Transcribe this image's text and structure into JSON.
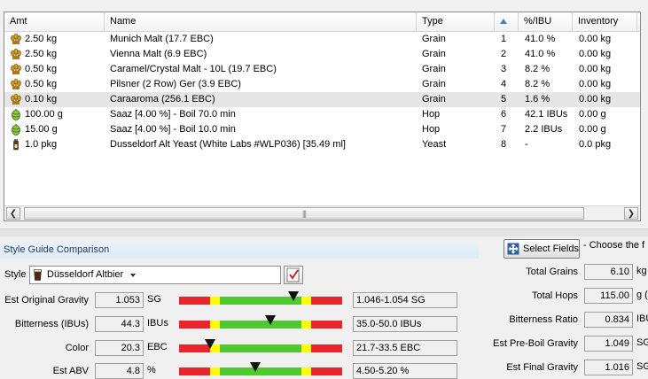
{
  "grid": {
    "columns": [
      "Amt",
      "Name",
      "Type",
      "",
      "%/IBU",
      "Inventory"
    ],
    "rows": [
      {
        "amt": "2.50 kg",
        "name": "Munich Malt (17.7 EBC)",
        "type": "Grain",
        "order": "1",
        "pct": "41.0 %",
        "inv": "0.00 kg",
        "icon": "grain-icon"
      },
      {
        "amt": "2.50 kg",
        "name": "Vienna Malt (6.9 EBC)",
        "type": "Grain",
        "order": "2",
        "pct": "41.0 %",
        "inv": "0.00 kg",
        "icon": "grain-icon"
      },
      {
        "amt": "0.50 kg",
        "name": "Caramel/Crystal Malt - 10L (19.7 EBC)",
        "type": "Grain",
        "order": "3",
        "pct": "8.2 %",
        "inv": "0.00 kg",
        "icon": "grain-icon"
      },
      {
        "amt": "0.50 kg",
        "name": "Pilsner (2 Row) Ger (3.9 EBC)",
        "type": "Grain",
        "order": "4",
        "pct": "8.2 %",
        "inv": "0.00 kg",
        "icon": "grain-icon"
      },
      {
        "amt": "0.10 kg",
        "name": "Caraaroma (256.1 EBC)",
        "type": "Grain",
        "order": "5",
        "pct": "1.6 %",
        "inv": "0.00 kg",
        "icon": "grain-icon"
      },
      {
        "amt": "100.00 g",
        "name": "Saaz [4.00 %] - Boil 70.0 min",
        "type": "Hop",
        "order": "6",
        "pct": "42.1 IBUs",
        "inv": "0.00 g",
        "icon": "hop-icon"
      },
      {
        "amt": "15.00 g",
        "name": "Saaz [4.00 %] - Boil 10.0 min",
        "type": "Hop",
        "order": "7",
        "pct": "2.2 IBUs",
        "inv": "0.00 g",
        "icon": "hop-icon"
      },
      {
        "amt": "1.0 pkg",
        "name": "Dusseldorf Alt Yeast (White Labs #WLP036) [35.49 ml]",
        "type": "Yeast",
        "order": "8",
        "pct": "-",
        "inv": "0.0 pkg",
        "icon": "yeast-icon"
      }
    ],
    "selected_row": 5
  },
  "style_guide": {
    "title": "Style Guide Comparison",
    "style_label": "Style",
    "style_value": "Düsseldorf Altbier",
    "metrics": [
      {
        "label": "Est Original Gravity",
        "value": "1.053",
        "unit": "SG",
        "range": "1.046-1.054 SG",
        "marker_pct": 0.7
      },
      {
        "label": "Bitterness (IBUs)",
        "value": "44.3",
        "unit": "IBUs",
        "range": "35.0-50.0 IBUs",
        "marker_pct": 0.56
      },
      {
        "label": "Color",
        "value": "20.3",
        "unit": "EBC",
        "range": "21.7-33.5 EBC",
        "marker_pct": 0.19
      },
      {
        "label": "Est ABV",
        "value": "4.8",
        "unit": "%",
        "range": "4.50-5.20 %",
        "marker_pct": 0.47
      }
    ],
    "colors": {
      "red": "#e8242c",
      "yellow": "#ffff00",
      "green": "#50c832",
      "marker": "#111111"
    }
  },
  "panel": {
    "select_fields_label": "Select Fields",
    "choose_text": "- Choose the f",
    "stats": [
      {
        "label": "Total Grains",
        "value": "6.10",
        "unit": "kg"
      },
      {
        "label": "Total Hops",
        "value": "115.00",
        "unit": "g ("
      },
      {
        "label": "Bitterness Ratio",
        "value": "0.834",
        "unit": "IBU"
      },
      {
        "label": "Est Pre-Boil Gravity",
        "value": "1.049",
        "unit": "SG"
      },
      {
        "label": "Est Final Gravity",
        "value": "1.016",
        "unit": "SG"
      }
    ]
  }
}
